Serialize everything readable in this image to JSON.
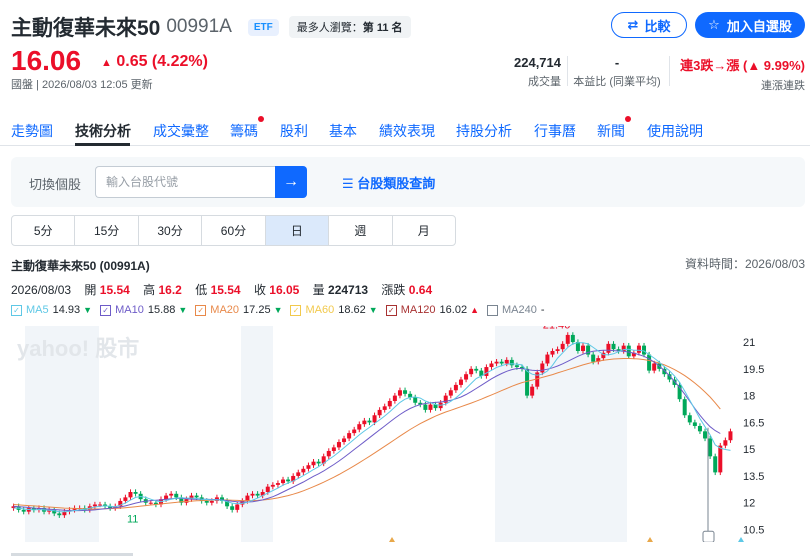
{
  "header": {
    "name": "主動復華未來50",
    "code": "00991A",
    "etf_badge": "ETF",
    "popular_label": "最多人瀏覽：",
    "popular_rank": "第 11 名",
    "compare_label": "比較",
    "watchlist_label": "加入自選股"
  },
  "quote": {
    "price": "16.06",
    "change": "0.65 (4.22%)",
    "meta": "國盤 | 2026/08/03 12:05 更新",
    "volume_value": "224,714",
    "volume_label": "成交量",
    "pe_value": "-",
    "pe_label": "本益比 (同業平均)",
    "streak_value": "連3跌→漲 (▲ 9.99%)",
    "streak_label": "連漲連跌"
  },
  "tabs": [
    {
      "label": "走勢圖",
      "dot": false
    },
    {
      "label": "技術分析",
      "dot": false
    },
    {
      "label": "成交彙整",
      "dot": false
    },
    {
      "label": "籌碼",
      "dot": true
    },
    {
      "label": "股利",
      "dot": false
    },
    {
      "label": "基本",
      "dot": false
    },
    {
      "label": "績效表現",
      "dot": false
    },
    {
      "label": "持股分析",
      "dot": false
    },
    {
      "label": "行事曆",
      "dot": false
    },
    {
      "label": "新聞",
      "dot": true
    },
    {
      "label": "使用說明",
      "dot": false
    }
  ],
  "switcher": {
    "label": "切換個股",
    "placeholder": "輸入台股代號",
    "lookup_label": "台股類股查詢"
  },
  "periods": [
    "5分",
    "15分",
    "30分",
    "60分",
    "日",
    "週",
    "月"
  ],
  "selected_period": "日",
  "chart_header": {
    "title": "主動復華未來50 (00991A)",
    "data_time": "資料時間：2026/08/03",
    "date": "2026/08/03",
    "open_label": "開",
    "open": "15.54",
    "high_label": "高",
    "high": "16.2",
    "low_label": "低",
    "low": "15.54",
    "close_label": "收",
    "close": "16.05",
    "vol_label": "量",
    "vol": "224713",
    "chg_label": "漲跌",
    "chg": "0.64"
  },
  "ma_legend": [
    {
      "name": "MA5",
      "value": "14.93",
      "dir": "down",
      "color": "#5ec8e6"
    },
    {
      "name": "MA10",
      "value": "15.88",
      "dir": "down",
      "color": "#6e5cc8"
    },
    {
      "name": "MA20",
      "value": "17.25",
      "dir": "down",
      "color": "#e8894a"
    },
    {
      "name": "MA60",
      "value": "18.62",
      "dir": "down",
      "color": "#f2c94c"
    },
    {
      "name": "MA120",
      "value": "16.02",
      "dir": "up",
      "color": "#a83232"
    },
    {
      "name": "MA240",
      "value": "-",
      "dir": "none",
      "color": "#7a8591"
    }
  ],
  "colors": {
    "up": "#eb0f29",
    "down": "#00a85a",
    "accent": "#0f69ff"
  },
  "chart_data": {
    "type": "candlestick",
    "watermark": "yahoo! 股市",
    "y_ticks": [
      21,
      19.5,
      18,
      16.5,
      15,
      13.5,
      12,
      10.5
    ],
    "ylim": [
      9.8,
      21.9
    ],
    "grid": false,
    "max_label": "21.46",
    "min_label": "11",
    "closes": [
      11.8,
      11.6,
      11.5,
      11.7,
      11.6,
      11.7,
      11.5,
      11.6,
      11.4,
      11.3,
      11.5,
      11.6,
      11.7,
      11.7,
      11.6,
      11.8,
      11.9,
      11.9,
      11.8,
      11.7,
      11.8,
      12.1,
      12.3,
      12.6,
      12.5,
      12.2,
      12.0,
      12.0,
      11.9,
      12.2,
      12.4,
      12.5,
      12.3,
      12.0,
      12.2,
      12.4,
      12.3,
      12.1,
      12.0,
      12.1,
      12.3,
      12.1,
      11.8,
      11.6,
      11.9,
      12.1,
      12.4,
      12.5,
      12.4,
      12.6,
      12.9,
      13.0,
      13.1,
      13.3,
      13.2,
      13.5,
      13.7,
      13.9,
      14.1,
      14.3,
      14.2,
      14.6,
      14.9,
      15.1,
      15.4,
      15.6,
      15.9,
      16.1,
      16.4,
      16.6,
      16.5,
      16.9,
      17.2,
      17.4,
      17.7,
      18.0,
      18.3,
      18.1,
      17.9,
      17.6,
      17.5,
      17.2,
      17.5,
      17.3,
      17.6,
      18.0,
      18.3,
      18.6,
      18.9,
      19.2,
      19.5,
      19.4,
      19.1,
      19.6,
      19.8,
      19.9,
      19.8,
      20.0,
      19.7,
      19.6,
      19.5,
      18.0,
      18.5,
      19.3,
      19.8,
      20.3,
      20.5,
      20.6,
      20.9,
      21.4,
      21.0,
      20.5,
      20.8,
      20.3,
      19.9,
      20.1,
      20.4,
      20.9,
      20.6,
      20.5,
      20.8,
      20.2,
      20.4,
      20.8,
      20.3,
      19.4,
      19.8,
      19.5,
      19.2,
      18.9,
      18.6,
      17.8,
      16.9,
      16.5,
      16.3,
      16.0,
      15.6,
      14.6,
      13.7,
      15.2,
      15.5,
      16.0
    ],
    "ma5": [
      11.7,
      11.7,
      11.65,
      11.62,
      11.6,
      11.62,
      11.6,
      11.58,
      11.55,
      11.5,
      11.5,
      11.52,
      11.56,
      11.6,
      11.64,
      11.7,
      11.76,
      11.8,
      11.82,
      11.8,
      11.78,
      11.86,
      11.98,
      12.15,
      12.3,
      12.35,
      12.3,
      12.2,
      12.1,
      12.06,
      12.12,
      12.2,
      12.26,
      12.28,
      12.26,
      12.26,
      12.24,
      12.2,
      12.18,
      12.16,
      12.16,
      12.14,
      12.06,
      11.98,
      11.94,
      11.96,
      12.02,
      12.14,
      12.26,
      12.4,
      12.54,
      12.68,
      12.82,
      12.98,
      13.1,
      13.22,
      13.36,
      13.52,
      13.68,
      13.86,
      14.02,
      14.22,
      14.42,
      14.62,
      14.84,
      15.08,
      15.32,
      15.56,
      15.8,
      16.02,
      16.22,
      16.44,
      16.64,
      16.86,
      17.1,
      17.36,
      17.62,
      17.8,
      17.9,
      17.92,
      17.86,
      17.7,
      17.6,
      17.5,
      17.46,
      17.52,
      17.68,
      17.88,
      18.12,
      18.4,
      18.68,
      18.96,
      19.1,
      19.26,
      19.42,
      19.58,
      19.68,
      19.76,
      19.78,
      19.76,
      19.72,
      19.36,
      19.2,
      19.14,
      19.2,
      19.38,
      19.7,
      20.1,
      20.4,
      20.7,
      20.9,
      20.96,
      20.96,
      20.9,
      20.7,
      20.5,
      20.3,
      20.28,
      20.34,
      20.46,
      20.58,
      20.6,
      20.54,
      20.54,
      20.5,
      20.3,
      20.1,
      19.88,
      19.62,
      19.4,
      19.1,
      18.74,
      18.26,
      17.74,
      17.22,
      16.7,
      16.26,
      15.8,
      15.24,
      15.06,
      14.98,
      14.93
    ],
    "ma10": [
      11.8,
      11.78,
      11.76,
      11.73,
      11.7,
      11.68,
      11.66,
      11.64,
      11.62,
      11.6,
      11.58,
      11.56,
      11.56,
      11.56,
      11.57,
      11.58,
      11.6,
      11.63,
      11.66,
      11.69,
      11.72,
      11.76,
      11.82,
      11.9,
      11.98,
      12.04,
      12.08,
      12.12,
      12.14,
      12.16,
      12.2,
      12.22,
      12.24,
      12.24,
      12.22,
      12.2,
      12.2,
      12.2,
      12.2,
      12.18,
      12.18,
      12.16,
      12.12,
      12.08,
      12.06,
      12.04,
      12.04,
      12.06,
      12.1,
      12.16,
      12.24,
      12.34,
      12.46,
      12.6,
      12.74,
      12.88,
      13.02,
      13.16,
      13.32,
      13.48,
      13.62,
      13.78,
      13.96,
      14.14,
      14.34,
      14.54,
      14.76,
      14.98,
      15.2,
      15.42,
      15.64,
      15.86,
      16.08,
      16.3,
      16.52,
      16.74,
      16.94,
      17.12,
      17.28,
      17.4,
      17.5,
      17.56,
      17.6,
      17.62,
      17.64,
      17.68,
      17.74,
      17.82,
      17.92,
      18.06,
      18.22,
      18.4,
      18.58,
      18.76,
      18.94,
      19.1,
      19.24,
      19.36,
      19.46,
      19.52,
      19.52,
      19.46,
      19.42,
      19.4,
      19.42,
      19.48,
      19.56,
      19.66,
      19.78,
      19.92,
      20.06,
      20.2,
      20.32,
      20.42,
      20.48,
      20.52,
      20.54,
      20.54,
      20.52,
      20.5,
      20.48,
      20.44,
      20.38,
      20.3,
      20.2,
      20.06,
      19.88,
      19.66,
      19.4,
      19.12,
      18.8,
      18.46,
      18.08,
      17.68,
      17.28,
      16.9,
      16.56,
      16.26,
      16.04,
      15.88
    ],
    "ma20": [
      11.9,
      11.88,
      11.86,
      11.84,
      11.82,
      11.8,
      11.78,
      11.76,
      11.74,
      11.72,
      11.7,
      11.69,
      11.68,
      11.67,
      11.66,
      11.65,
      11.65,
      11.65,
      11.66,
      11.67,
      11.68,
      11.7,
      11.72,
      11.75,
      11.78,
      11.81,
      11.84,
      11.87,
      11.9,
      11.93,
      11.96,
      11.99,
      12.02,
      12.05,
      12.07,
      12.09,
      12.11,
      12.12,
      12.13,
      12.14,
      12.15,
      12.15,
      12.15,
      12.14,
      12.13,
      12.12,
      12.12,
      12.12,
      12.13,
      12.15,
      12.18,
      12.22,
      12.27,
      12.33,
      12.4,
      12.48,
      12.57,
      12.67,
      12.78,
      12.9,
      13.02,
      13.15,
      13.29,
      13.43,
      13.58,
      13.74,
      13.9,
      14.07,
      14.24,
      14.42,
      14.6,
      14.78,
      14.97,
      15.16,
      15.35,
      15.54,
      15.73,
      15.92,
      16.1,
      16.27,
      16.43,
      16.58,
      16.72,
      16.85,
      16.97,
      17.08,
      17.18,
      17.28,
      17.38,
      17.48,
      17.58,
      17.69,
      17.8,
      17.92,
      18.04,
      18.16,
      18.28,
      18.4,
      18.52,
      18.63,
      18.73,
      18.8,
      18.87,
      18.94,
      19.02,
      19.1,
      19.18,
      19.27,
      19.36,
      19.45,
      19.54,
      19.63,
      19.72,
      19.8,
      19.87,
      19.93,
      19.98,
      20.02,
      20.05,
      20.07,
      20.08,
      20.08,
      20.07,
      20.05,
      20.02,
      19.97,
      19.9,
      19.82,
      19.72,
      19.6,
      19.46,
      19.3,
      19.12,
      18.92,
      18.7,
      18.46,
      18.2,
      17.92,
      17.6,
      17.25
    ]
  }
}
